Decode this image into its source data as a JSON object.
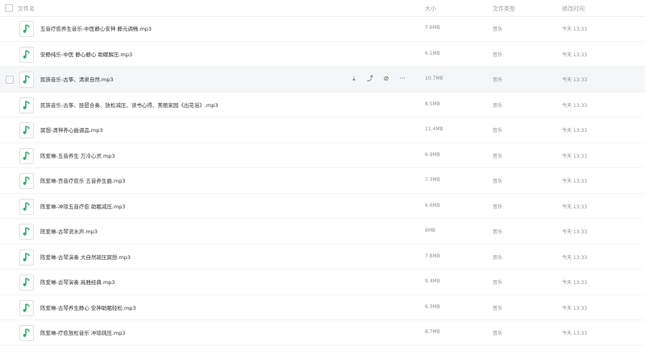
{
  "header": {
    "name_label": "文件名",
    "size_label": "大小",
    "type_label": "文件类型",
    "time_label": "修改时间"
  },
  "files": [
    {
      "name": "五音疗愈养生音乐-中医静心安神 静元调畅.mp3",
      "size": "7.6MB",
      "type": "音乐",
      "time": "今天 13:33"
    },
    {
      "name": "安静纯乐-中医 静心静心 助眠解压.mp3",
      "size": "6.1MB",
      "type": "音乐",
      "time": "今天 13:33"
    },
    {
      "name": "民族音乐-古筝、清泉自然.mp3",
      "size": "10.7MB",
      "type": "音乐",
      "time": "今天 13:33"
    },
    {
      "name": "民族音乐-古筝、琵琶合奏、放松减压、读书心得、美丽家园《出花谣》.mp3",
      "size": "8.5MB",
      "type": "音乐",
      "time": "今天 13:33"
    },
    {
      "name": "冥想-清神养心曲调品.mp3",
      "size": "11.4MB",
      "type": "音乐",
      "time": "今天 13:33"
    },
    {
      "name": "陈爱琳-五音养生 万冷心灵.mp3",
      "size": "6.9MB",
      "type": "音乐",
      "time": "今天 13:33"
    },
    {
      "name": "陈爱琳-宫音疗愈乐 五音养生曲.mp3",
      "size": "7.3MB",
      "type": "音乐",
      "time": "今天 13:33"
    },
    {
      "name": "陈爱琳-冲琅五音疗愈 助眠减压.mp3",
      "size": "6.6MB",
      "type": "音乐",
      "time": "今天 13:33"
    },
    {
      "name": "陈爱琳-古琴流水声.mp3",
      "size": "6MB",
      "type": "音乐",
      "time": "今天 13:33"
    },
    {
      "name": "陈爱琳-古琴演奏 大自然疏压冥想.mp3",
      "size": "7.8MB",
      "type": "音乐",
      "time": "今天 13:33"
    },
    {
      "name": "陈爱琳-古琴演奏 高雅经典.mp3",
      "size": "9.4MB",
      "type": "音乐",
      "time": "今天 13:33"
    },
    {
      "name": "陈爱琳-古琴养生静心 安神助眠轻松.mp3",
      "size": "6.3MB",
      "type": "音乐",
      "time": "今天 13:33"
    },
    {
      "name": "陈爱琳-疗愈放松音乐 冲琅疏压.mp3",
      "size": "8.7MB",
      "type": "音乐",
      "time": "今天 13:33"
    }
  ],
  "hover_row_index": 2,
  "row_actions": [
    {
      "icon": "download-icon",
      "glyph": "⤓"
    },
    {
      "icon": "share-icon",
      "glyph": "⤴"
    },
    {
      "icon": "link-icon",
      "glyph": "⊘"
    },
    {
      "icon": "more-icon",
      "glyph": "···"
    }
  ],
  "colors": {
    "accent": "#2fb166"
  }
}
